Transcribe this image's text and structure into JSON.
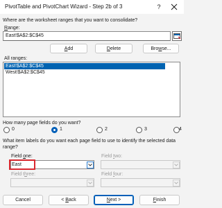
{
  "window": {
    "title": "PivotTable and PivotChart Wizard - Step 2b of 3",
    "help_glyph": "?"
  },
  "ranges_prompt": "Where are the worksheet ranges that you want to consolidate?",
  "range": {
    "label": "Range:",
    "value": "East!$A$2:$C$45"
  },
  "buttons": {
    "add": "Add",
    "delete": "Delete",
    "browse": "Browse..."
  },
  "all_ranges": {
    "label": "All ranges:",
    "items": [
      "East!$A$2:$C$45",
      "West!$A$2:$C$45"
    ],
    "selected_index": 0
  },
  "page_fields": {
    "question": "How many page fields do you want?",
    "options": [
      "0",
      "1",
      "2",
      "3",
      "4"
    ],
    "selected": "1"
  },
  "item_labels_prompt": "What item labels do you want each page field to use to identify the selected data range?",
  "fields": {
    "one": {
      "label": "Field one:",
      "value": "East"
    },
    "two": {
      "label": "Field two:"
    },
    "three": {
      "label": "Field three:"
    },
    "four": {
      "label": "Field four:"
    }
  },
  "footer": {
    "cancel": "Cancel",
    "back": "< Back",
    "next": "Next >",
    "finish": "Finish"
  },
  "colors": {
    "accent": "#005fb8",
    "selection": "#0063b1",
    "highlight_box": "#d9282f"
  }
}
